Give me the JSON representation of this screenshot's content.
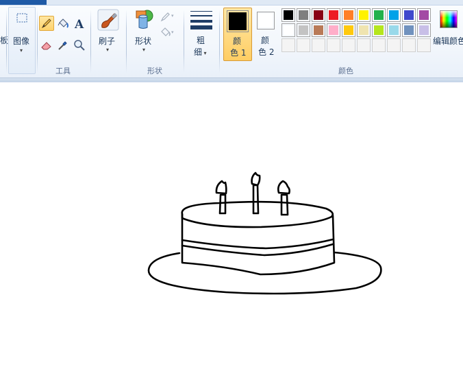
{
  "ribbon": {
    "clipboard_partial_label": "板",
    "image": {
      "label": "图像"
    },
    "tools": {
      "group_label": "工具"
    },
    "brushes": {
      "label": "刷子"
    },
    "shapes": {
      "label": "形状",
      "group_label": "形状"
    },
    "size": {
      "label_line1": "粗",
      "label_line2": "细"
    },
    "color1": {
      "label_line1": "颜",
      "label_line2": "色 1",
      "color": "#000000"
    },
    "color2": {
      "label_line1": "颜",
      "label_line2": "色 2",
      "color": "#ffffff"
    },
    "colors_group_label": "颜色",
    "edit_colors": {
      "label": "编辑颜色"
    },
    "palette_row1": [
      "#000000",
      "#7f7f7f",
      "#880015",
      "#ed1c24",
      "#ff7f27",
      "#fff200",
      "#22b14c",
      "#00a2e8",
      "#3f48cc",
      "#a349a4"
    ],
    "palette_row2": [
      "#ffffff",
      "#c3c3c3",
      "#b97a57",
      "#ffaec9",
      "#ffc90e",
      "#efe4b0",
      "#b5e61d",
      "#99d9ea",
      "#7092be",
      "#c8bfe7"
    ]
  }
}
